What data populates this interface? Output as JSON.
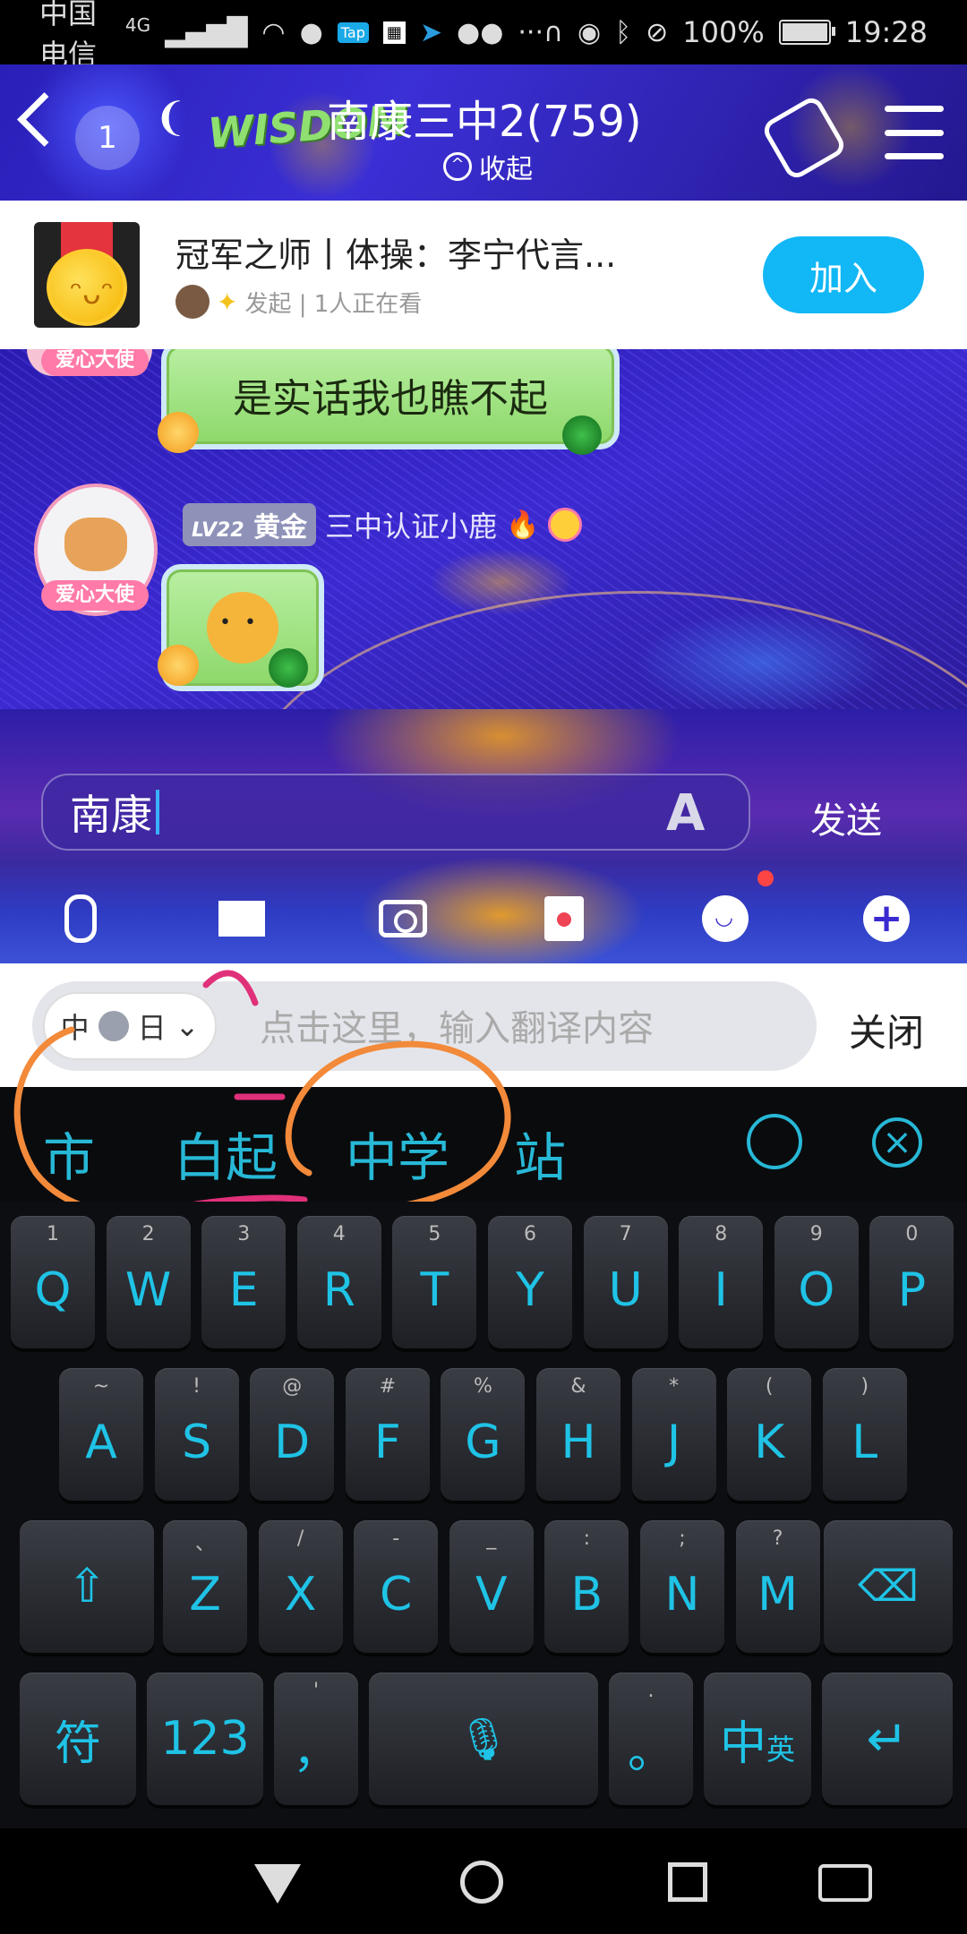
{
  "status_bar": {
    "carrier": "中国电信",
    "network": "4G",
    "battery": "100%",
    "battery_level": 1.0,
    "time": "19:28"
  },
  "header": {
    "unread_count": "1",
    "logo": "WISDOM",
    "title": "南康三中2(759)",
    "collapse_label": "收起"
  },
  "banner": {
    "title": "冠军之师丨体操：李宁代言...",
    "subtitle": "发起 | 1人正在看",
    "join_label": "加入"
  },
  "chat": {
    "messages": [
      {
        "text": "是实话我也瞧不起",
        "badge": "爱心大使"
      },
      {
        "level": "LV22",
        "rank": "黄金",
        "nickname": "三中认证小鹿",
        "badge": "爱心大使",
        "sticker": "dog-sticker"
      }
    ]
  },
  "input": {
    "value": "南康",
    "send_label": "发送"
  },
  "translate": {
    "lang_from": "中",
    "lang_to": "日",
    "placeholder": "点击这里，输入翻译内容",
    "close_label": "关闭"
  },
  "candidates": [
    "市",
    "白起",
    "中学",
    "站"
  ],
  "keyboard": {
    "row1": [
      {
        "sub": "1",
        "key": "Q"
      },
      {
        "sub": "2",
        "key": "W"
      },
      {
        "sub": "3",
        "key": "E"
      },
      {
        "sub": "4",
        "key": "R"
      },
      {
        "sub": "5",
        "key": "T"
      },
      {
        "sub": "6",
        "key": "Y"
      },
      {
        "sub": "7",
        "key": "U"
      },
      {
        "sub": "8",
        "key": "I"
      },
      {
        "sub": "9",
        "key": "O"
      },
      {
        "sub": "0",
        "key": "P"
      }
    ],
    "row2": [
      {
        "sub": "~",
        "key": "A"
      },
      {
        "sub": "!",
        "key": "S"
      },
      {
        "sub": "@",
        "key": "D"
      },
      {
        "sub": "#",
        "key": "F"
      },
      {
        "sub": "%",
        "key": "G"
      },
      {
        "sub": "&",
        "key": "H"
      },
      {
        "sub": "*",
        "key": "J"
      },
      {
        "sub": "(",
        "key": "K"
      },
      {
        "sub": ")",
        "key": "L"
      }
    ],
    "row3": [
      {
        "sub": "、",
        "key": "Z"
      },
      {
        "sub": "/",
        "key": "X"
      },
      {
        "sub": "-",
        "key": "C"
      },
      {
        "sub": "_",
        "key": "V"
      },
      {
        "sub": ":",
        "key": "B"
      },
      {
        "sub": ";",
        "key": "N"
      },
      {
        "sub": "?",
        "key": "M"
      }
    ],
    "symbols_label": "符",
    "numbers_label": "123",
    "comma_label": "，",
    "comma_sub": "'",
    "period_label": "。",
    "period_sub": ".",
    "lang_label": "中",
    "lang_label_small": "英"
  },
  "colors": {
    "accent": "#12b7f5",
    "key_text": "#1fc3e6",
    "annotation_orange": "#f28a3a",
    "annotation_pink": "#e0307a"
  }
}
